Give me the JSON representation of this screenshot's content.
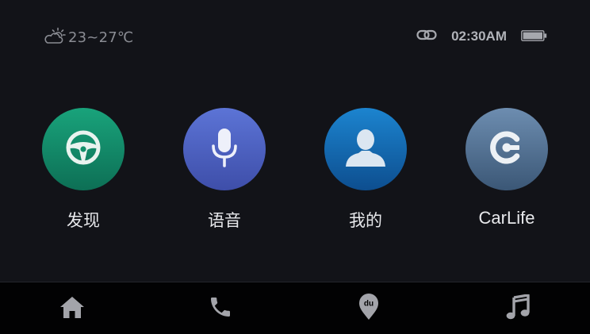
{
  "status_bar": {
    "temperature": "23~27℃",
    "weather_icon": "partly-cloudy-icon",
    "link_icon": "link-icon",
    "time": "02:30AM",
    "battery_icon": "battery-icon"
  },
  "apps": [
    {
      "label": "发现",
      "icon": "steering-wheel-icon",
      "colors": [
        "#19a37b",
        "#0d6f55"
      ]
    },
    {
      "label": "语音",
      "icon": "microphone-icon",
      "colors": [
        "#5c74d6",
        "#3e4ea9"
      ]
    },
    {
      "label": "我的",
      "icon": "user-icon",
      "colors": [
        "#1c84cf",
        "#0d4e8f"
      ]
    },
    {
      "label": "CarLife",
      "icon": "carlife-logo-icon",
      "colors": [
        "#6d8db0",
        "#3b5776"
      ]
    }
  ],
  "dock": [
    {
      "icon": "home-icon"
    },
    {
      "icon": "phone-icon"
    },
    {
      "icon": "map-pin-du-icon",
      "badge": "du"
    },
    {
      "icon": "music-icon"
    }
  ],
  "colors": {
    "background": "#121318",
    "dock_background": "#020203",
    "icon_gray": "#a3a4aa"
  }
}
